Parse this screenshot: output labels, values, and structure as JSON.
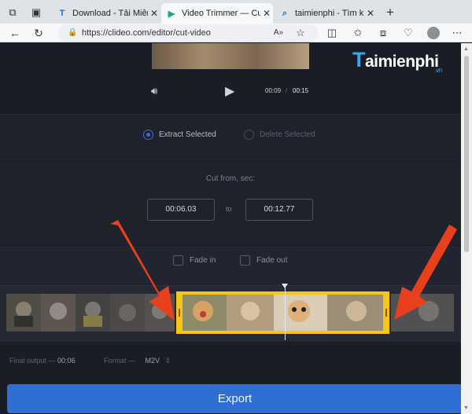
{
  "browser": {
    "tabs": [
      {
        "title": "Download - Tải Miễn Ph",
        "favicon": "T",
        "favicon_color": "#1e73be"
      },
      {
        "title": "Video Trimmer — Cut V",
        "favicon": "▶",
        "favicon_color": "#1fa38e"
      },
      {
        "title": "taimienphi - Tìm kiếm",
        "favicon": "⌕",
        "favicon_color": "#1e73be"
      }
    ],
    "url": "https://clideo.com/editor/cut-video",
    "new_tab": "+"
  },
  "player": {
    "current_time": "00:09",
    "separator": "/",
    "total_time": "00:15"
  },
  "watermark": {
    "brand": "aimienphi",
    "initial": "T",
    "suffix": ".vn"
  },
  "mode": {
    "extract_label": "Extract Selected",
    "delete_label": "Delete Selected",
    "selected": "extract"
  },
  "cut": {
    "label": "Cut from, sec:",
    "from": "00:06.03",
    "to_label": "to",
    "to": "00:12.77"
  },
  "fade": {
    "fade_in": "Fade in",
    "fade_out": "Fade out"
  },
  "timeline": {
    "selection_start_fraction": 0.384,
    "selection_end_fraction": 0.84,
    "playhead_fraction": 0.615
  },
  "output": {
    "final_label": "Final output —",
    "final_value": "00:06",
    "format_label": "Format —",
    "format_value": "M2V"
  },
  "export_label": "Export",
  "colors": {
    "accent": "#2f6fd4",
    "selection": "#f5c518",
    "annotation_arrow": "#e8401c"
  }
}
